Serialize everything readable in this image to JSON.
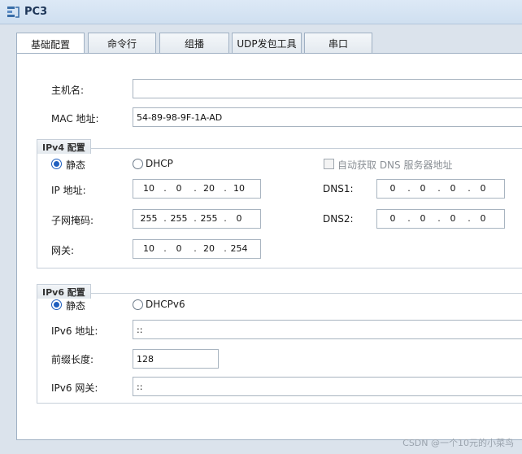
{
  "window": {
    "title": "PC3"
  },
  "tabs": [
    {
      "label": "基础配置",
      "active": true
    },
    {
      "label": "命令行",
      "active": false
    },
    {
      "label": "组播",
      "active": false
    },
    {
      "label": "UDP发包工具",
      "active": false
    },
    {
      "label": "串口",
      "active": false
    }
  ],
  "basic": {
    "hostname_label": "主机名:",
    "hostname_value": "",
    "mac_label": "MAC 地址:",
    "mac_value": "54-89-98-9F-1A-AD"
  },
  "ipv4": {
    "legend": "IPv4 配置",
    "static_label": "静态",
    "dhcp_label": "DHCP",
    "mode": "static",
    "auto_dns_label": "自动获取 DNS 服务器地址",
    "auto_dns_checked": false,
    "ip_label": "IP 地址:",
    "ip": [
      "10",
      "0",
      "20",
      "10"
    ],
    "mask_label": "子网掩码:",
    "mask": [
      "255",
      "255",
      "255",
      "0"
    ],
    "gateway_label": "网关:",
    "gateway": [
      "10",
      "0",
      "20",
      "254"
    ],
    "dns1_label": "DNS1:",
    "dns1": [
      "0",
      "0",
      "0",
      "0"
    ],
    "dns2_label": "DNS2:",
    "dns2": [
      "0",
      "0",
      "0",
      "0"
    ]
  },
  "ipv6": {
    "legend": "IPv6 配置",
    "static_label": "静态",
    "dhcp_label": "DHCPv6",
    "mode": "static",
    "ip_label": "IPv6 地址:",
    "ip_value": "::",
    "prefix_label": "前缀长度:",
    "prefix_value": "128",
    "gateway_label": "IPv6 网关:",
    "gateway_value": "::"
  },
  "footer": {
    "watermark": "CSDN @一个10元的小菜鸟"
  },
  "colors": {
    "titlebar": "#dde9f6",
    "body": "#dbe3ec",
    "accent": "#1f5fbf"
  },
  "icons": {
    "app_icon": "pc-network-icon"
  }
}
